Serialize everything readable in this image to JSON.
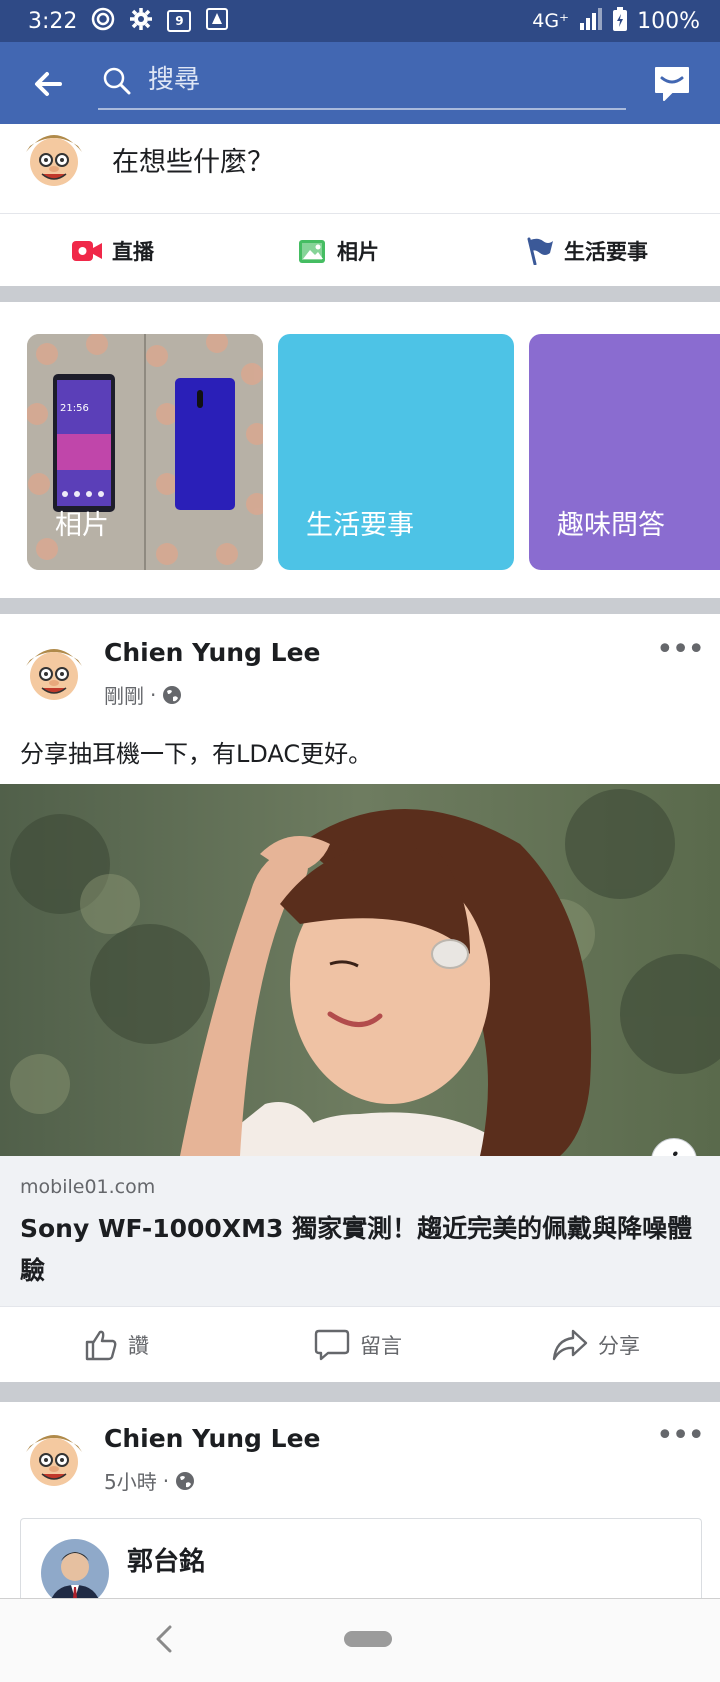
{
  "status_bar": {
    "time": "3:22",
    "calendar_day": "9",
    "network": "4G⁺",
    "battery": "100%"
  },
  "topbar": {
    "search_placeholder": "搜尋"
  },
  "composer": {
    "prompt": "在想些什麼？",
    "actions": [
      {
        "label": "直播",
        "icon": "live-video-icon"
      },
      {
        "label": "相片",
        "icon": "photo-icon"
      },
      {
        "label": "生活要事",
        "icon": "flag-icon"
      }
    ]
  },
  "cards": [
    {
      "label": "相片",
      "bg": "#b9b4ac"
    },
    {
      "label": "生活要事",
      "bg": "#4dc3e6"
    },
    {
      "label": "趣味問答",
      "bg": "#8a6cd0"
    }
  ],
  "post1": {
    "author": "Chien Yung Lee",
    "time": "剛剛",
    "text": "分享抽耳機一下，有LDAC更好。",
    "link_domain": "mobile01.com",
    "link_title": "Sony WF-1000XM3 獨家實測！趨近完美的佩戴與降噪體驗"
  },
  "reactions": {
    "like": "讚",
    "comment": "留言",
    "share": "分享"
  },
  "post2": {
    "author": "Chien Yung Lee",
    "time": "5小時",
    "shared_author": "郭台銘"
  },
  "colors": {
    "brand": "#4267b2",
    "status_bar": "#2f4a86",
    "divider": "#c9ccd1",
    "live_red": "#f02849",
    "photo_green": "#45bd62",
    "flag_blue": "#3b5998"
  }
}
